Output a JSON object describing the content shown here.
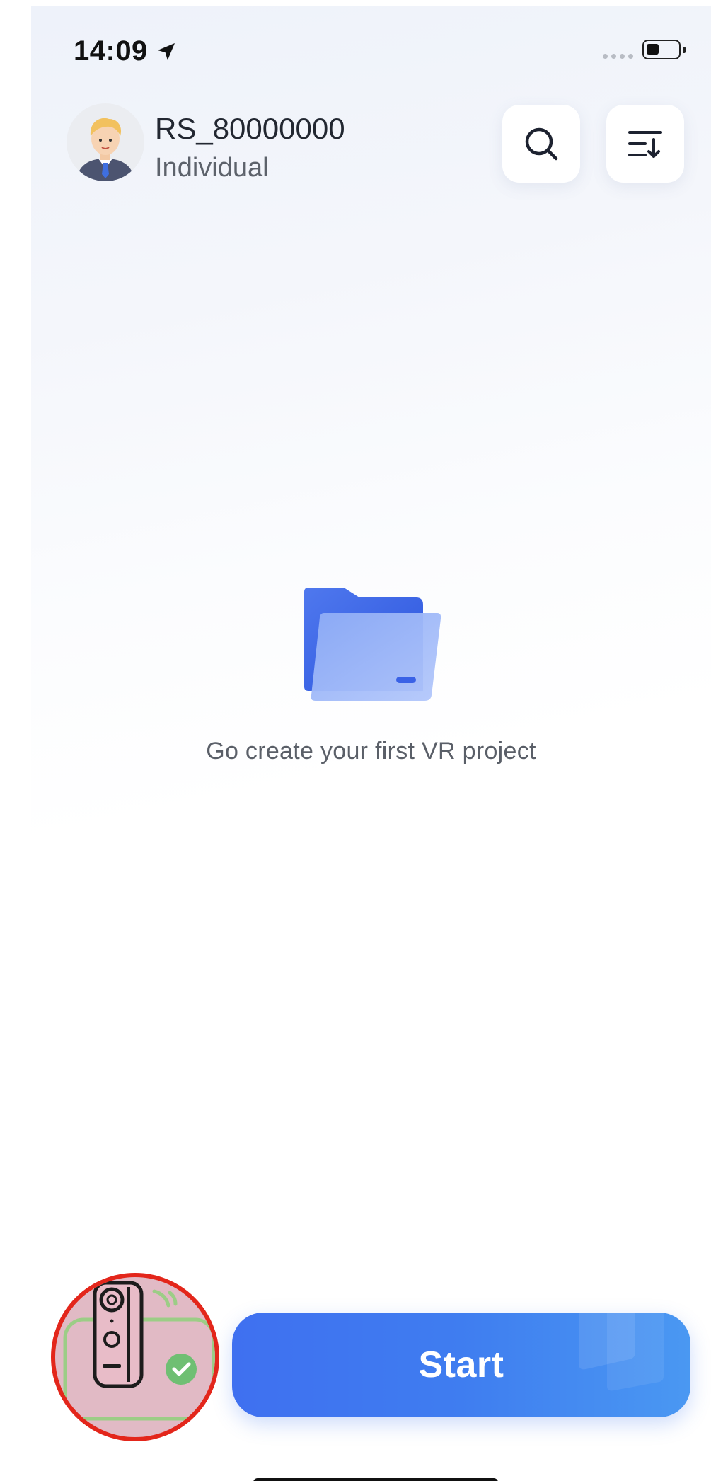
{
  "status_bar": {
    "time": "14:09",
    "location_icon": "location-arrow-icon",
    "battery_icon": "battery-icon"
  },
  "profile": {
    "username": "RS_80000000",
    "account_type": "Individual",
    "avatar_icon": "user-avatar-icon"
  },
  "toolbar": {
    "search_icon": "search-icon",
    "sort_icon": "sort-icon"
  },
  "empty_state": {
    "icon": "folder-icon",
    "message": "Go create your first VR project"
  },
  "bottom": {
    "device_icon": "vr-camera-connected-icon",
    "start_label": "Start"
  },
  "colors": {
    "accent": "#3f74f0",
    "highlight_ring": "#e3261b",
    "check_green": "#6fbf73"
  }
}
